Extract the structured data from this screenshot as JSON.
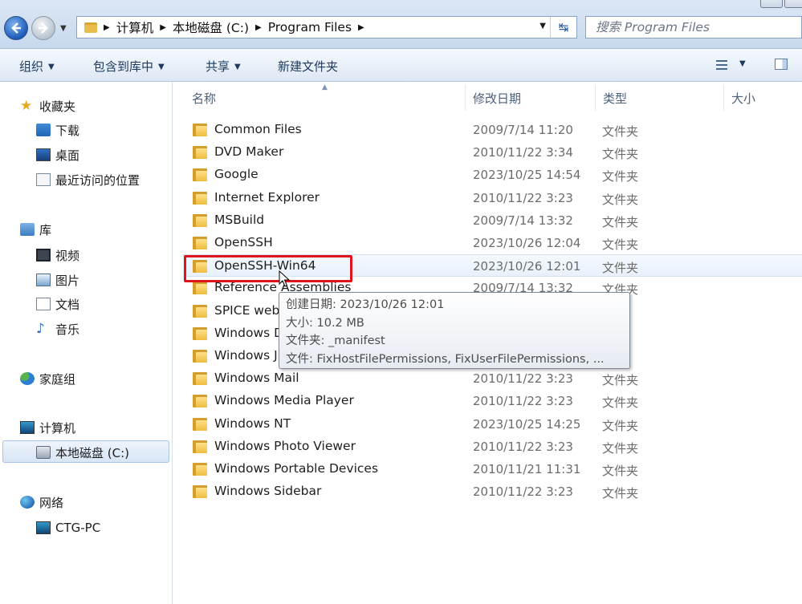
{
  "address_bar": {
    "breadcrumbs": [
      "计算机",
      "本地磁盘 (C:)",
      "Program Files"
    ],
    "search_placeholder": "搜索 Program Files"
  },
  "toolbar": {
    "organize": "组织",
    "include_in_library": "包含到库中",
    "share": "共享",
    "new_folder": "新建文件夹"
  },
  "nav": {
    "favorites": "收藏夹",
    "downloads": "下载",
    "desktop": "桌面",
    "recent": "最近访问的位置",
    "libraries": "库",
    "videos": "视频",
    "pictures": "图片",
    "documents": "文档",
    "music": "音乐",
    "homegroup": "家庭组",
    "computer": "计算机",
    "local_disk": "本地磁盘 (C:)",
    "network": "网络",
    "network_pc": "CTG-PC"
  },
  "columns": {
    "name": "名称",
    "modified": "修改日期",
    "type": "类型",
    "size": "大小"
  },
  "files": [
    {
      "name": "Common Files",
      "date": "2009/7/14 11:20",
      "type": "文件夹"
    },
    {
      "name": "DVD Maker",
      "date": "2010/11/22 3:34",
      "type": "文件夹"
    },
    {
      "name": "Google",
      "date": "2023/10/25 14:54",
      "type": "文件夹"
    },
    {
      "name": "Internet Explorer",
      "date": "2010/11/22 3:23",
      "type": "文件夹"
    },
    {
      "name": "MSBuild",
      "date": "2009/7/14 13:32",
      "type": "文件夹"
    },
    {
      "name": "OpenSSH",
      "date": "2023/10/26 12:04",
      "type": "文件夹"
    },
    {
      "name": "OpenSSH-Win64",
      "date": "2023/10/26 12:01",
      "type": "文件夹"
    },
    {
      "name": "Reference Assemblies",
      "date": "2009/7/14 13:32",
      "type": "文件夹"
    },
    {
      "name": "SPICE web",
      "date": "",
      "type": "夹"
    },
    {
      "name": "Windows D",
      "date": "",
      "type": "夹"
    },
    {
      "name": "Windows J",
      "date": "",
      "type": "夹"
    },
    {
      "name": "Windows Mail",
      "date": "2010/11/22 3:23",
      "type": "文件夹"
    },
    {
      "name": "Windows Media Player",
      "date": "2010/11/22 3:23",
      "type": "文件夹"
    },
    {
      "name": "Windows NT",
      "date": "2023/10/25 14:25",
      "type": "文件夹"
    },
    {
      "name": "Windows Photo Viewer",
      "date": "2010/11/22 3:23",
      "type": "文件夹"
    },
    {
      "name": "Windows Portable Devices",
      "date": "2010/11/21 11:31",
      "type": "文件夹"
    },
    {
      "name": "Windows Sidebar",
      "date": "2010/11/22 3:23",
      "type": "文件夹"
    }
  ],
  "tooltip": {
    "created": "创建日期: 2023/10/26 12:01",
    "size": "大小: 10.2 MB",
    "folders": "文件夹: _manifest",
    "files": "文件: FixHostFilePermissions, FixUserFilePermissions, ..."
  },
  "colors": {
    "highlight_box": "#e0141c",
    "folder": "#f0bc3e"
  },
  "icons": [
    "back-icon",
    "forward-icon",
    "folder-icon",
    "refresh-icon",
    "view-icon",
    "preview-pane-icon",
    "star-icon",
    "cursor-icon"
  ]
}
